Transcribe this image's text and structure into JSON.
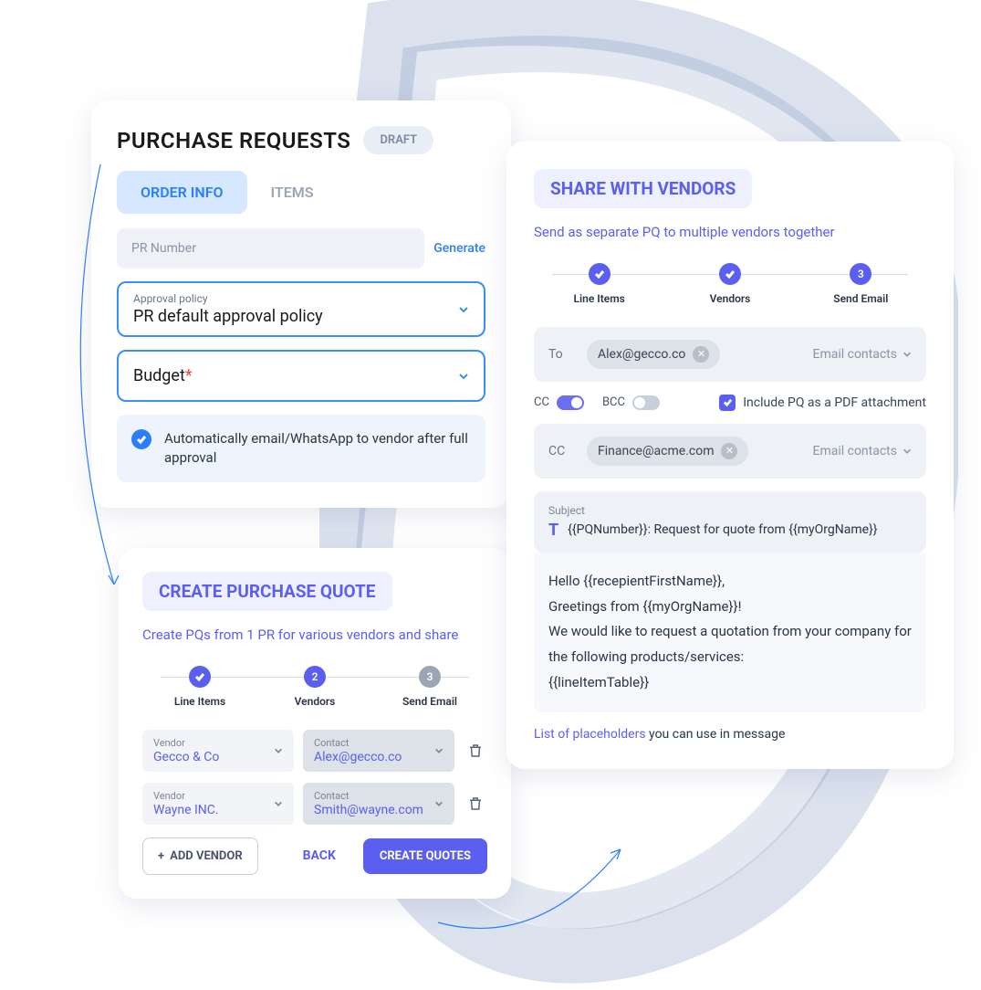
{
  "purchaseRequests": {
    "title": "PURCHASE REQUESTS",
    "status": "DRAFT",
    "tabOrderInfo": "ORDER INFO",
    "tabItems": "ITEMS",
    "prNumberPlaceholder": "PR Number",
    "generateLabel": "Generate",
    "approvalPolicyLabel": "Approval policy",
    "approvalPolicyValue": "PR default approval policy",
    "budgetLabel": "Budget",
    "autoEmailText": "Automatically email/WhatsApp to vendor after full approval"
  },
  "createQuote": {
    "title": "CREATE PURCHASE QUOTE",
    "subtitle": "Create PQs from 1 PR for various vendors and share",
    "step1": "Line Items",
    "step2": "Vendors",
    "step3": "Send Email",
    "vendorLabel": "Vendor",
    "contactLabel": "Contact",
    "rows": [
      {
        "vendor": "Gecco & Co",
        "contact": "Alex@gecco.co"
      },
      {
        "vendor": "Wayne INC.",
        "contact": "Smith@wayne.com"
      }
    ],
    "addVendor": "ADD VENDOR",
    "back": "BACK",
    "createQuotes": "CREATE QUOTES"
  },
  "share": {
    "title": "SHARE WITH VENDORS",
    "subtitle": "Send as separate PQ to multiple vendors together",
    "step1": "Line Items",
    "step2": "Vendors",
    "step3": "Send Email",
    "step3num": "3",
    "toLabel": "To",
    "toChip": "Alex@gecco.co",
    "emailContacts": "Email contacts",
    "ccLabel": "CC",
    "bccLabel": "BCC",
    "includePdf": "Include PQ as a PDF attachment",
    "ccChip": "Finance@acme.com",
    "subjectLabel": "Subject",
    "subjectValue": "{{PQNumber}}: Request for quote from {{myOrgName}}",
    "body1": "Hello {{recepientFirstName}},",
    "body2": "Greetings from {{myOrgName}}!",
    "body3": "We would like to request a quotation from your company for the following products/services:",
    "body4": "{{lineItemTable}}",
    "placeholderLink": "List of placeholders",
    "placeholderText": " you can use in message"
  }
}
